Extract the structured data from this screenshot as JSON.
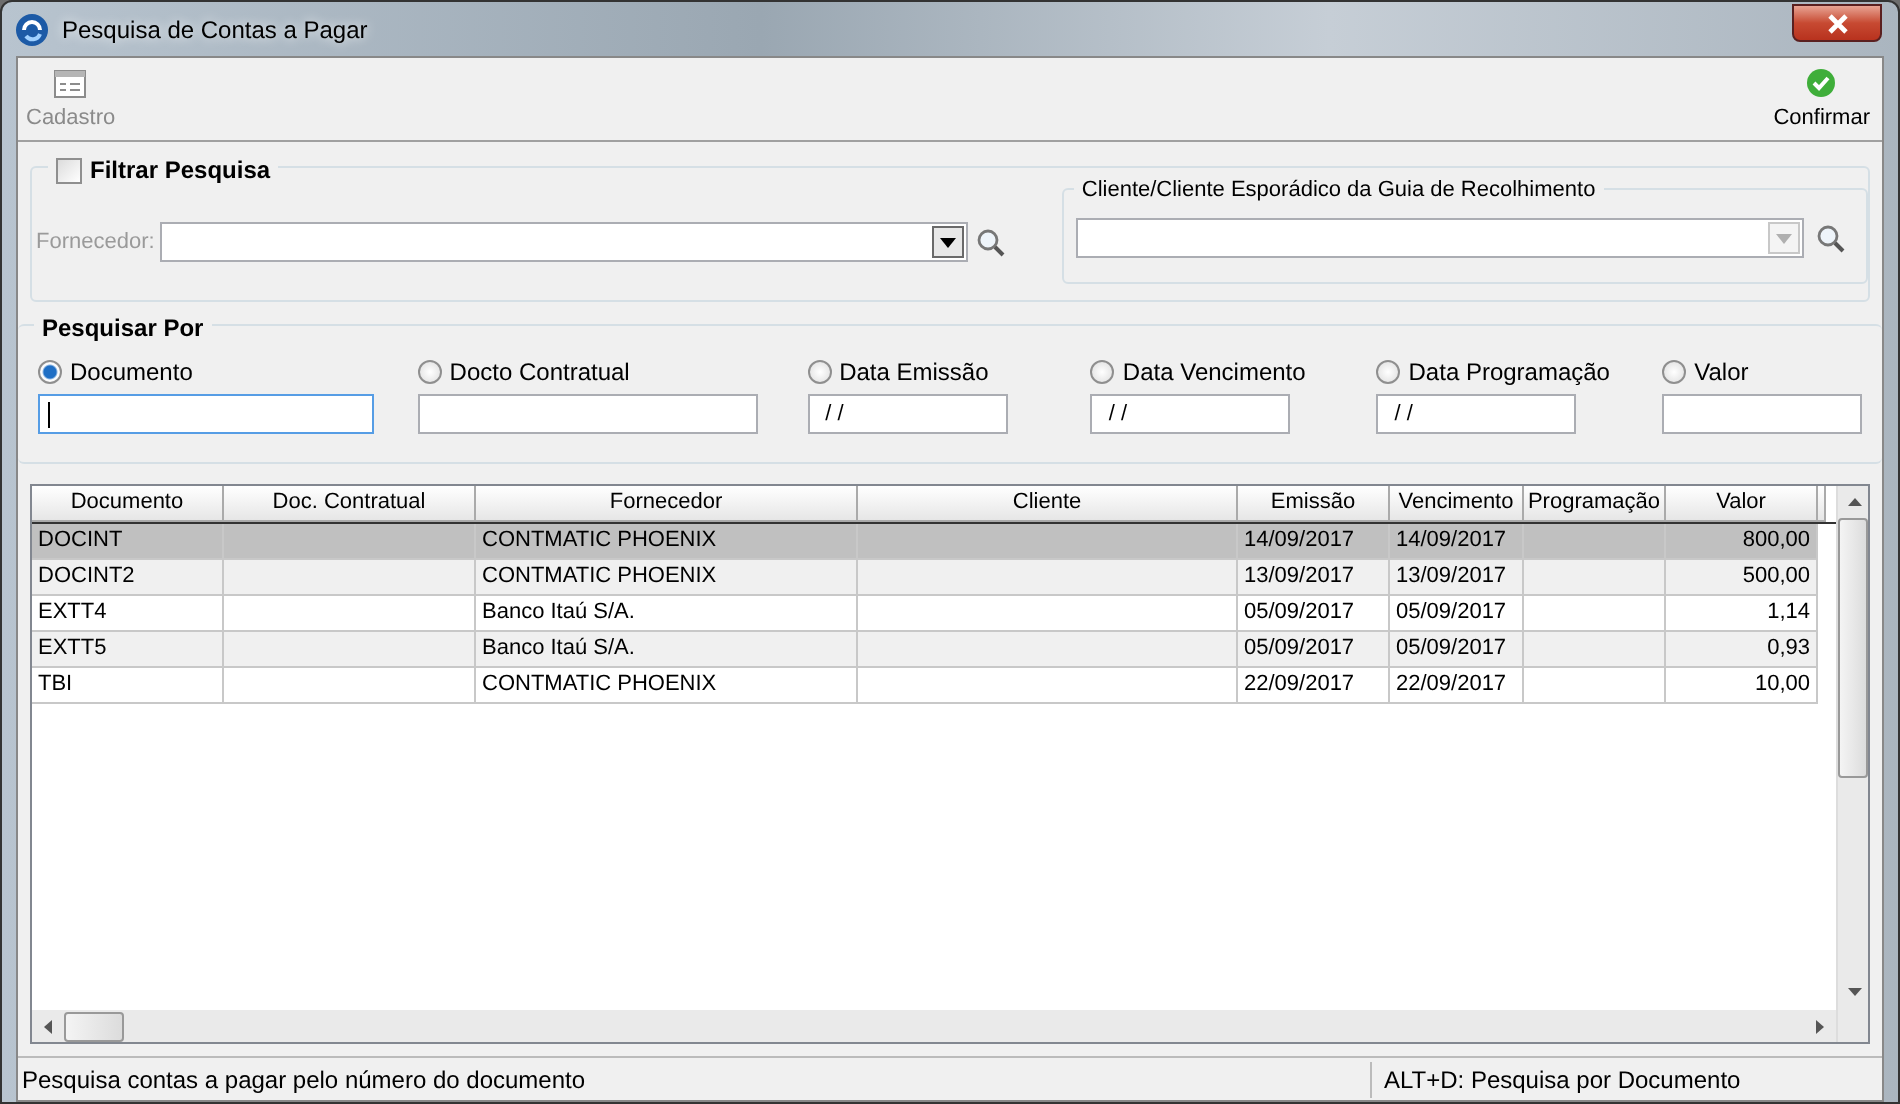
{
  "window": {
    "title": "Pesquisa de Contas a Pagar"
  },
  "toolbar": [
    {
      "kind": "form",
      "label": "Cadastro",
      "disabled": true
    },
    {
      "kind": "confirm",
      "label": "Confirmar",
      "disabled": false
    }
  ],
  "filter": {
    "label": "Filtrar Pesquisa",
    "checked": false,
    "fornecedor": {
      "label": "Fornecedor:",
      "disabled": true
    },
    "cliente": {
      "title": "Cliente/Cliente Esporádico da Guia de Recolhimento",
      "disabled": true
    }
  },
  "search_by": {
    "title": "Pesquisar Por",
    "options": [
      {
        "label": "Documento",
        "selected": true,
        "focused": true
      },
      {
        "label": "Docto Contratual",
        "selected": false,
        "focused": false
      },
      {
        "label": "Data Emissão",
        "selected": false,
        "focused": false,
        "value": "/ /"
      },
      {
        "label": "Data Vencimento",
        "selected": false,
        "focused": false,
        "value": "/ /"
      },
      {
        "label": "Data Programação",
        "selected": false,
        "focused": false,
        "value": "/ /"
      },
      {
        "label": "Valor",
        "selected": false,
        "focused": false
      }
    ]
  },
  "table": {
    "columns": [
      {
        "label": "Documento",
        "kind": "text"
      },
      {
        "label": "Doc. Contratual",
        "kind": "text"
      },
      {
        "label": "Fornecedor",
        "kind": "text"
      },
      {
        "label": "Cliente",
        "kind": "text"
      },
      {
        "label": "Emissão",
        "kind": "text"
      },
      {
        "label": "Vencimento",
        "kind": "text"
      },
      {
        "label": "Programação",
        "kind": "text"
      },
      {
        "label": "Valor",
        "kind": "number"
      }
    ],
    "rows": [
      {
        "selected": true,
        "cells": [
          "DOCINT",
          null,
          "CONTMATIC PHOENIX",
          null,
          "14/09/2017",
          "14/09/2017",
          null,
          "800,00"
        ]
      },
      {
        "selected": false,
        "cells": [
          "DOCINT2",
          null,
          "CONTMATIC PHOENIX",
          null,
          "13/09/2017",
          "13/09/2017",
          null,
          "500,00"
        ]
      },
      {
        "selected": false,
        "cells": [
          "EXTT4",
          null,
          "Banco Itaú S/A.",
          null,
          "05/09/2017",
          "05/09/2017",
          null,
          "1,14"
        ]
      },
      {
        "selected": false,
        "cells": [
          "EXTT5",
          null,
          "Banco Itaú S/A.",
          null,
          "05/09/2017",
          "05/09/2017",
          null,
          "0,93"
        ]
      },
      {
        "selected": false,
        "cells": [
          "TBI",
          null,
          "CONTMATIC PHOENIX",
          null,
          "22/09/2017",
          "22/09/2017",
          null,
          "10,00"
        ]
      }
    ]
  },
  "status_bar": {
    "left": "Pesquisa contas a pagar pelo número do documento",
    "right": "ALT+D: Pesquisa por Documento"
  }
}
